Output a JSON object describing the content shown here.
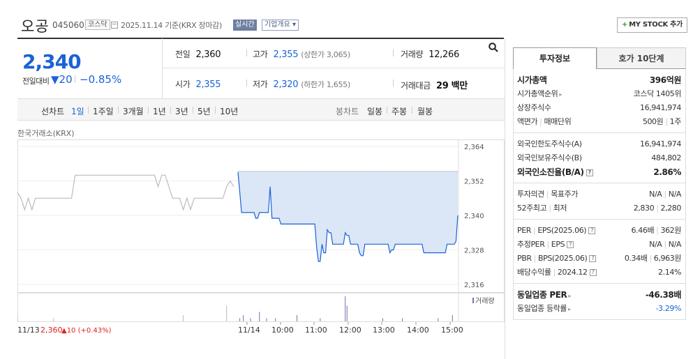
{
  "header": {
    "name": "오공",
    "code": "045060",
    "market": "코스닥",
    "date": "2025.11.14 기준(KRX 장마감)",
    "live": "실시간",
    "company_overview": "기업개요",
    "mystock": "MY STOCK 추가"
  },
  "price": {
    "current": "2,340",
    "change_label": "전일대비",
    "change_value": "▼20",
    "change_percent": "−0.85%"
  },
  "summary": {
    "prev_close_label": "전일",
    "prev_close": "2,360",
    "high_label": "고가",
    "high": "2,355",
    "upper_limit": "(상한가 3,065)",
    "volume_label": "거래량",
    "volume": "12,266",
    "open_label": "시가",
    "open": "2,355",
    "low_label": "저가",
    "low": "2,320",
    "lower_limit": "(하한가 1,655)",
    "amount_label": "거래대금",
    "amount": "29 백만"
  },
  "periods": {
    "line_label": "선차트",
    "items": [
      "1일",
      "1주일",
      "3개월",
      "1년",
      "3년",
      "5년",
      "10년"
    ],
    "candle_label": "봉차트",
    "candles": [
      "일봉",
      "주봉",
      "월봉"
    ]
  },
  "source": "한국거래소(KRX)",
  "tabs": [
    "투자정보",
    "호가 10단계"
  ],
  "invest": {
    "mcap_label": "시가총액",
    "mcap": "396억원",
    "rank_label": "시가총액순위",
    "rank": "코스닥 1405위",
    "shares_label": "상장주식수",
    "shares": "16,941,974",
    "par_label": "액면가",
    "unit_label": "매매단위",
    "par": "500원",
    "unit": "1주",
    "foreign_limit_label": "외국인한도주식수(A)",
    "foreign_limit": "16,941,974",
    "foreign_hold_label": "외국인보유주식수(B)",
    "foreign_hold": "484,802",
    "foreign_ratio_label": "외국인소진율(B/A)",
    "foreign_ratio": "2.86%",
    "opinion_label": "투자의견",
    "target_label": "목표주가",
    "opinion": "N/A",
    "target": "N/A",
    "w52_label": "52주최고",
    "w52low_label": "최저",
    "w52high": "2,830",
    "w52low": "2,280",
    "per_label": "PER",
    "eps_label": "EPS(2025.06)",
    "per": "6.46배",
    "eps": "362원",
    "eper_label": "추정PER",
    "eeps_label": "EPS",
    "eper": "N/A",
    "eeps": "N/A",
    "pbr_label": "PBR",
    "bps_label": "BPS(2025.06)",
    "pbr": "0.34배",
    "bps": "6,963원",
    "div_label": "배당수익률",
    "div_year": "2024.12",
    "div": "2.14%",
    "sector_per_label": "동일업종 PER",
    "sector_per": "-46.38배",
    "sector_chg_label": "동일업종 등락률",
    "sector_chg": "-3.29%"
  },
  "colors": {
    "up": "#e02020",
    "down": "#1a62d6",
    "fill": "#dbe6f7"
  },
  "chart_data": {
    "type": "line",
    "y_ticks": [
      "2,364",
      "2,352",
      "2,340",
      "2,328",
      "2,316"
    ],
    "ylim": [
      2316,
      2364
    ],
    "x_ticks": [
      "11/14",
      "10:00",
      "11:00",
      "12:00",
      "13:00",
      "14:00",
      "15:00"
    ],
    "prev_day_label": "11/13",
    "prev_day_close": "2,360",
    "prev_day_change": "▲10 (+0.43%)",
    "volume_legend": "거래량",
    "prev_day_series": [
      2348,
      2346,
      2342,
      2346,
      2342,
      2346,
      2346,
      2346,
      2346,
      2346,
      2346,
      2346,
      2346,
      2346,
      2346,
      2346,
      2354,
      2354,
      2354,
      2354,
      2354,
      2354,
      2354,
      2354,
      2354,
      2354,
      2354,
      2354,
      2354,
      2354,
      2354,
      2354,
      2354,
      2354,
      2354,
      2354,
      2354,
      2354,
      2354,
      2350,
      2354,
      2354,
      2350,
      2346,
      2346,
      2346,
      2342,
      2346,
      2342,
      2346,
      2346,
      2346,
      2346,
      2346,
      2346,
      2346,
      2346,
      2346,
      2350,
      2352,
      2350
    ],
    "today_series": [
      2355,
      2348,
      2341,
      2341,
      2341,
      2341,
      2341,
      2341,
      2341,
      2341,
      2339,
      2339,
      2341,
      2341,
      2341,
      2341,
      2341,
      2341,
      2350,
      2339,
      2339,
      2339,
      2339,
      2339,
      2337,
      2337,
      2337,
      2337,
      2337,
      2337,
      2337,
      2337,
      2337,
      2337,
      2337,
      2337,
      2337,
      2337,
      2337,
      2337,
      2337,
      2337,
      2337,
      2337,
      2329,
      2324,
      2324,
      2330,
      2327,
      2327,
      2335,
      2334,
      2334,
      2330,
      2330,
      2330,
      2330,
      2330,
      2330,
      2330,
      2334,
      2333,
      2333,
      2330,
      2330,
      2330,
      2330,
      2330,
      2327,
      2326,
      2326,
      2330,
      2330,
      2330,
      2330,
      2330,
      2330,
      2330,
      2330,
      2330,
      2330,
      2330,
      2330,
      2330,
      2330,
      2327,
      2328,
      2328,
      2330,
      2330,
      2330,
      2330,
      2330,
      2330,
      2330,
      2330,
      2330,
      2330,
      2330,
      2330,
      2330,
      2330,
      2330,
      2330,
      2327,
      2327,
      2327,
      2327,
      2327,
      2327,
      2327,
      2327,
      2327,
      2327,
      2327,
      2327,
      2327,
      2330,
      2330,
      2330,
      2330,
      2330,
      2331,
      2340
    ],
    "volume_today": [
      0,
      1,
      0,
      2,
      0,
      0,
      0,
      1,
      0,
      0,
      0,
      0,
      3,
      0,
      0,
      0,
      1,
      0,
      0,
      0,
      0,
      1,
      0,
      0,
      0,
      0,
      0,
      0,
      0,
      0,
      0,
      0,
      0,
      2,
      0,
      0,
      0,
      0,
      0,
      0,
      0,
      0,
      0,
      0,
      0,
      0,
      1,
      0,
      0,
      0,
      0,
      0,
      0,
      0,
      0,
      0,
      0,
      0,
      0,
      0,
      8,
      5,
      0,
      0,
      0,
      0,
      0,
      0,
      0,
      0,
      0,
      0,
      0,
      0,
      0,
      0,
      0,
      0,
      0,
      0,
      0,
      1,
      0,
      0,
      0,
      0,
      0,
      0,
      0,
      0,
      0,
      0,
      1,
      0,
      0,
      0,
      0,
      0,
      0,
      0,
      0,
      0,
      0,
      0,
      0,
      0,
      0,
      0,
      0,
      0,
      0,
      0,
      1,
      0,
      0,
      0,
      0,
      0,
      0,
      0,
      2,
      0,
      0
    ],
    "volume_prev": [
      2,
      0,
      0,
      0,
      0,
      0,
      0,
      0,
      0,
      0,
      1,
      0,
      0,
      0,
      0,
      0,
      0,
      0,
      0,
      0,
      0,
      0,
      0,
      0,
      0,
      0,
      0,
      0,
      0,
      0,
      0,
      0,
      0,
      0,
      0,
      0,
      0,
      0,
      0,
      0,
      0,
      0,
      0,
      0,
      0,
      0,
      2,
      0,
      0,
      0,
      0,
      0,
      0,
      0,
      0,
      0,
      0,
      0,
      5,
      0,
      0
    ]
  }
}
